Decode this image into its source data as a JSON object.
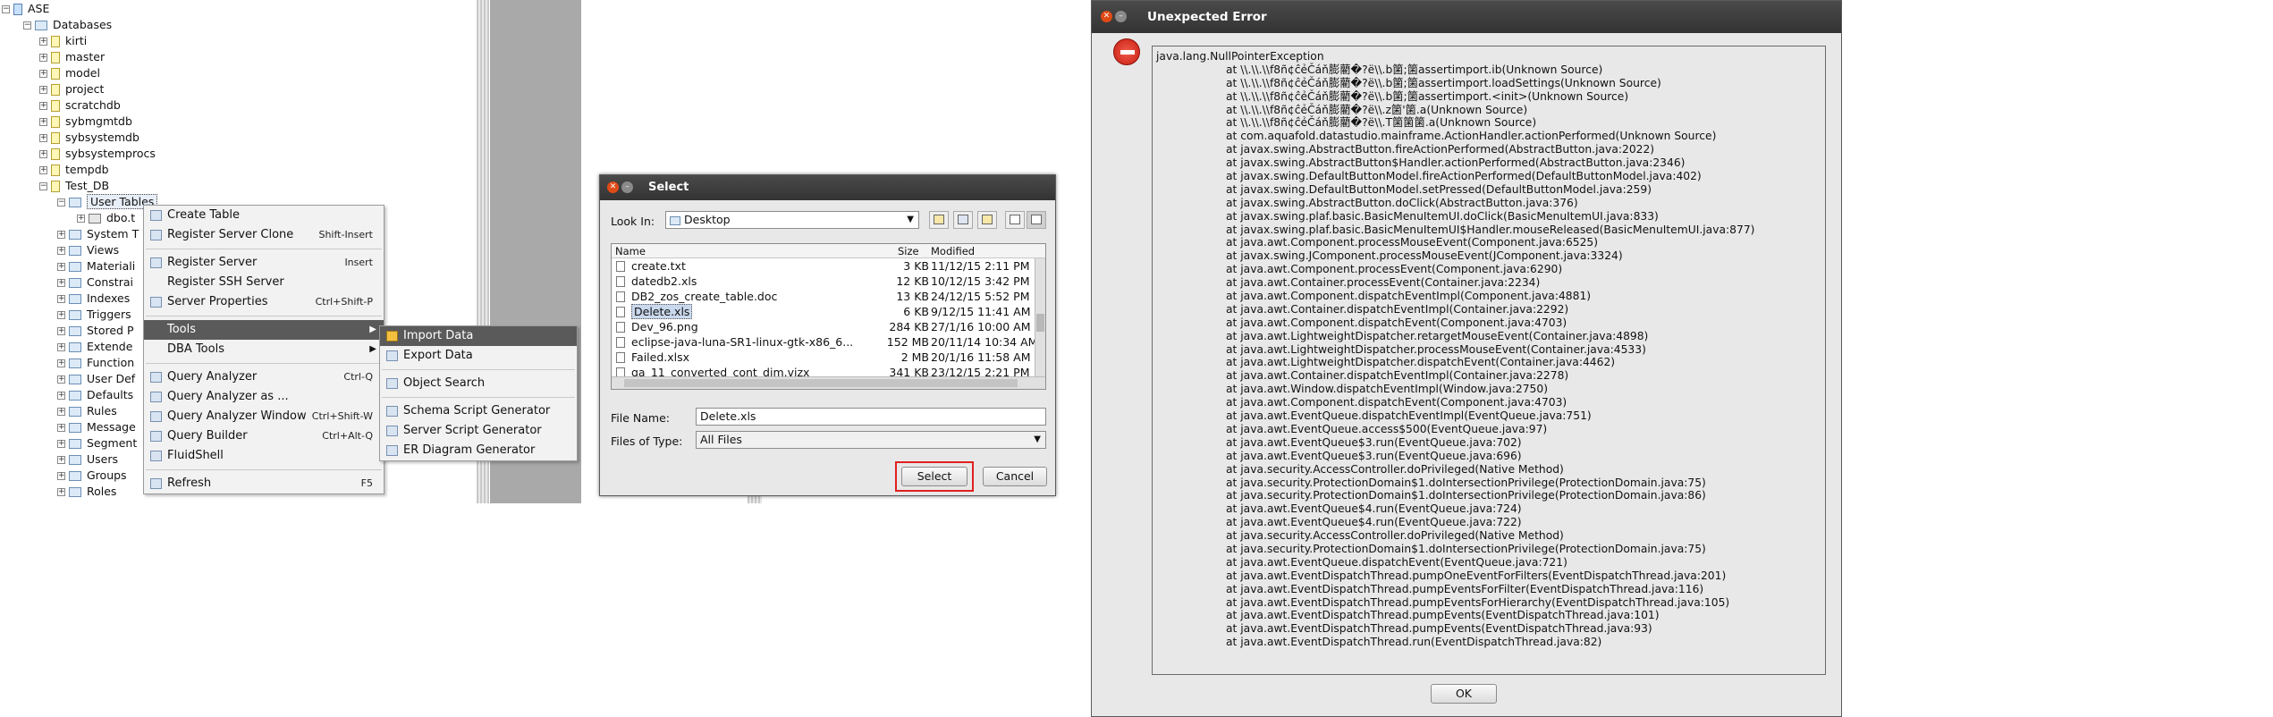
{
  "tree": {
    "root": "ASE",
    "databases_label": "Databases",
    "databases": [
      "kirti",
      "master",
      "model",
      "project",
      "scratchdb",
      "sybmgmtdb",
      "sybsystemdb",
      "sybsystemprocs",
      "tempdb",
      "Test_DB"
    ],
    "test_db_children": [
      "User Tables",
      "System T",
      "Views",
      "Materiali",
      "Constrai",
      "Indexes",
      "Triggers",
      "Stored P",
      "Extende",
      "Function",
      "User Def",
      "Defaults",
      "Rules",
      "Message",
      "Segment",
      "Users",
      "Groups",
      "Roles"
    ],
    "table_item": "dbo.t"
  },
  "context_menu": {
    "items": [
      {
        "label": "Create Table",
        "shortcut": ""
      },
      {
        "label": "Register Server Clone",
        "shortcut": "Shift-Insert"
      },
      {
        "label": "Register Server",
        "shortcut": "Insert"
      },
      {
        "label": "Register SSH Server",
        "shortcut": ""
      },
      {
        "label": "Server Properties",
        "shortcut": "Ctrl+Shift-P"
      },
      {
        "label": "Tools",
        "shortcut": ""
      },
      {
        "label": "DBA Tools",
        "shortcut": ""
      },
      {
        "label": "Query Analyzer",
        "shortcut": "Ctrl-Q"
      },
      {
        "label": "Query Analyzer as ...",
        "shortcut": ""
      },
      {
        "label": "Query Analyzer Window",
        "shortcut": "Ctrl+Shift-W"
      },
      {
        "label": "Query Builder",
        "shortcut": "Ctrl+Alt-Q"
      },
      {
        "label": "FluidShell",
        "shortcut": ""
      },
      {
        "label": "Refresh",
        "shortcut": "F5"
      }
    ]
  },
  "tools_submenu": {
    "items": [
      "Import Data",
      "Export Data",
      "Object Search",
      "Schema Script Generator",
      "Server Script Generator",
      "ER Diagram Generator"
    ]
  },
  "select_dialog": {
    "title": "Select",
    "look_in_label": "Look In:",
    "look_in_value": "Desktop",
    "columns": {
      "name": "Name",
      "size": "Size",
      "modified": "Modified"
    },
    "files": [
      {
        "name": "create.txt",
        "size": "3 KB",
        "modified": "11/12/15 2:11 PM"
      },
      {
        "name": "datedb2.xls",
        "size": "12 KB",
        "modified": "10/12/15 3:42 PM"
      },
      {
        "name": "DB2_zos_create_table.doc",
        "size": "13 KB",
        "modified": "24/12/15 5:52 PM"
      },
      {
        "name": "Delete.xls",
        "size": "6 KB",
        "modified": "9/12/15 11:41 AM"
      },
      {
        "name": "Dev_96.png",
        "size": "284 KB",
        "modified": "27/1/16 10:00 AM"
      },
      {
        "name": "eclipse-java-luna-SR1-linux-gtk-x86_6...",
        "size": "152 MB",
        "modified": "20/11/14 10:34 AM"
      },
      {
        "name": "Failed.xlsx",
        "size": "2 MB",
        "modified": "20/1/16 11:58 AM"
      },
      {
        "name": "qa_11_converted_cont_dim.vizx",
        "size": "341 KB",
        "modified": "23/12/15 2:21 PM"
      }
    ],
    "file_name_label": "File Name:",
    "file_name_value": "Delete.xls",
    "files_of_type_label": "Files of Type:",
    "files_of_type_value": "All Files",
    "select_button": "Select",
    "cancel_button": "Cancel"
  },
  "error_dialog": {
    "title": "Unexpected Error",
    "exception": "java.lang.NullPointerException",
    "trace": [
      "at \\\\.\\\\.\\\\f8ñ¢ĉẻČáň膨藺�?ë\\\\.b箘;箘assertimport.ib(Unknown Source)",
      "at \\\\.\\\\.\\\\f8ñ¢ĉẻČáň膨藺�?ë\\\\.b箘;箘assertimport.loadSettings(Unknown Source)",
      "at \\\\.\\\\.\\\\f8ñ¢ĉẻČáň膨藺�?ë\\\\.b箘;箘assertimport.<init>(Unknown Source)",
      "at \\\\.\\\\.\\\\f8ñ¢ĉẻČáň膨藺�?ë\\\\.z箘'箘.a(Unknown Source)",
      "at \\\\.\\\\.\\\\f8ñ¢ĉẻČáň膨藺�?ë\\\\.T箘箘箘.a(Unknown Source)",
      "at com.aquafold.datastudio.mainframe.ActionHandler.actionPerformed(Unknown Source)",
      "at javax.swing.AbstractButton.fireActionPerformed(AbstractButton.java:2022)",
      "at javax.swing.AbstractButton$Handler.actionPerformed(AbstractButton.java:2346)",
      "at javax.swing.DefaultButtonModel.fireActionPerformed(DefaultButtonModel.java:402)",
      "at javax.swing.DefaultButtonModel.setPressed(DefaultButtonModel.java:259)",
      "at javax.swing.AbstractButton.doClick(AbstractButton.java:376)",
      "at javax.swing.plaf.basic.BasicMenuItemUI.doClick(BasicMenuItemUI.java:833)",
      "at javax.swing.plaf.basic.BasicMenuItemUI$Handler.mouseReleased(BasicMenuItemUI.java:877)",
      "at java.awt.Component.processMouseEvent(Component.java:6525)",
      "at javax.swing.JComponent.processMouseEvent(JComponent.java:3324)",
      "at java.awt.Component.processEvent(Component.java:6290)",
      "at java.awt.Container.processEvent(Container.java:2234)",
      "at java.awt.Component.dispatchEventImpl(Component.java:4881)",
      "at java.awt.Container.dispatchEventImpl(Container.java:2292)",
      "at java.awt.Component.dispatchEvent(Component.java:4703)",
      "at java.awt.LightweightDispatcher.retargetMouseEvent(Container.java:4898)",
      "at java.awt.LightweightDispatcher.processMouseEvent(Container.java:4533)",
      "at java.awt.LightweightDispatcher.dispatchEvent(Container.java:4462)",
      "at java.awt.Container.dispatchEventImpl(Container.java:2278)",
      "at java.awt.Window.dispatchEventImpl(Window.java:2750)",
      "at java.awt.Component.dispatchEvent(Component.java:4703)",
      "at java.awt.EventQueue.dispatchEventImpl(EventQueue.java:751)",
      "at java.awt.EventQueue.access$500(EventQueue.java:97)",
      "at java.awt.EventQueue$3.run(EventQueue.java:702)",
      "at java.awt.EventQueue$3.run(EventQueue.java:696)",
      "at java.security.AccessController.doPrivileged(Native Method)",
      "at java.security.ProtectionDomain$1.doIntersectionPrivilege(ProtectionDomain.java:75)",
      "at java.security.ProtectionDomain$1.doIntersectionPrivilege(ProtectionDomain.java:86)",
      "at java.awt.EventQueue$4.run(EventQueue.java:724)",
      "at java.awt.EventQueue$4.run(EventQueue.java:722)",
      "at java.security.AccessController.doPrivileged(Native Method)",
      "at java.security.ProtectionDomain$1.doIntersectionPrivilege(ProtectionDomain.java:75)",
      "at java.awt.EventQueue.dispatchEvent(EventQueue.java:721)",
      "at java.awt.EventDispatchThread.pumpOneEventForFilters(EventDispatchThread.java:201)",
      "at java.awt.EventDispatchThread.pumpEventsForFilter(EventDispatchThread.java:116)",
      "at java.awt.EventDispatchThread.pumpEventsForHierarchy(EventDispatchThread.java:105)",
      "at java.awt.EventDispatchThread.pumpEvents(EventDispatchThread.java:101)",
      "at java.awt.EventDispatchThread.pumpEvents(EventDispatchThread.java:93)",
      "at java.awt.EventDispatchThread.run(EventDispatchThread.java:82)"
    ],
    "ok_button": "OK"
  },
  "colors": {
    "title_bar": "#3c3c3c",
    "close_button": "#df4b16",
    "menu_highlight": "#5a5a5a",
    "highlight_border": "#e02020",
    "error_icon": "#d62a1a"
  }
}
